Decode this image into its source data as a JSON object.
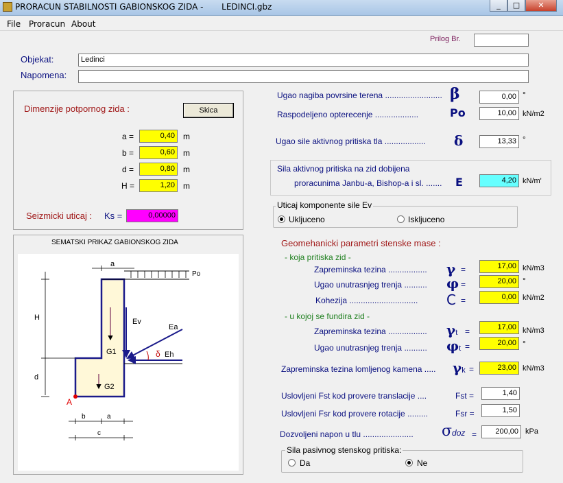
{
  "window": {
    "title": "PRORACUN STABILNOSTI GABIONSKOG ZIDA -       LEDINCI.gbz",
    "minimize": "_",
    "maximize": "□",
    "close": "✕"
  },
  "menu": [
    "File",
    "Proracun",
    "About"
  ],
  "prilog": {
    "label": "Prilog Br.",
    "value": ""
  },
  "objekat": {
    "label": "Objekat:",
    "value": "Ledinci"
  },
  "napomena": {
    "label": "Napomena:",
    "value": ""
  },
  "dimenzije": {
    "title": "Dimenzije potpornog zida :",
    "skica_button": "Skica",
    "fields": [
      {
        "name": "a =",
        "value": "0,40",
        "unit": "m"
      },
      {
        "name": "b =",
        "value": "0,60",
        "unit": "m"
      },
      {
        "name": "d =",
        "value": "0,80",
        "unit": "m"
      },
      {
        "name": "H =",
        "value": "1,20",
        "unit": "m"
      }
    ],
    "seizmicki_label": "Seizmicki uticaj :",
    "ks_label": "Ks =",
    "ks_value": "0,00000"
  },
  "schematic": {
    "title": "SEMATSKI PRIKAZ GABIONSKOG ZIDA",
    "labels": {
      "a": "a",
      "Po": "Po",
      "H": "H",
      "Ev": "Ev",
      "Ea": "Ea",
      "G1": "G1",
      "delta": "δ",
      "Eh": "Eh",
      "d": "d",
      "G2": "G2",
      "A": "A",
      "b": "b",
      "a2": "a",
      "c": "c"
    }
  },
  "right": {
    "beta": {
      "label": "Ugao nagiba povrsine terena",
      "dots": ".........................",
      "symbol": "β",
      "value": "0,00",
      "unit": "°"
    },
    "po": {
      "label": "Raspodeljeno opterecenje",
      "dots": "...................",
      "symbol": "Po",
      "value": "10,00",
      "unit": "kN/m2"
    },
    "delta": {
      "label": "Ugao sile aktivnog pritiska tla",
      "dots": "..................",
      "symbol": "δ",
      "value": "13,33",
      "unit": "°"
    },
    "e": {
      "line1": "Sila aktivnog pritiska na zid  dobijena",
      "line2": "proracunima Janbu-a, Bishop-a i sl.",
      "dots": ".......",
      "symbol": "E",
      "value": "4,20",
      "unit": "kN/m'"
    },
    "ev_group": {
      "title": "Uticaj komponente sile Ev",
      "opt1": "Ukljuceno",
      "opt2": "Iskljuceno",
      "selected": 1
    },
    "geo_title": "Geomehanicki parametri stenske mase :",
    "sub1": "- koja pritiska zid -",
    "sub2": "- u kojoj se fundira zid -",
    "gamma": {
      "label": "Zapreminska tezina",
      "dots": ".................",
      "symbol": "γ",
      "eq": "=",
      "value": "17,00",
      "unit": "kN/m3"
    },
    "phi": {
      "label": "Ugao unutrasnjeg trenja",
      "dots": "..........",
      "symbol": "φ",
      "eq": "=",
      "value": "20,00",
      "unit": "°"
    },
    "coh": {
      "label": "Kohezija",
      "dots": "..............................",
      "symbol": "C",
      "eq": "=",
      "value": "0,00",
      "unit": "kN/m2"
    },
    "gamma_t": {
      "label": "Zapreminska tezina",
      "dots": ".................",
      "symbol": "γ",
      "sub": "t",
      "eq": "=",
      "value": "17,00",
      "unit": "kN/m3"
    },
    "phi_t": {
      "label": "Ugao unutrasnjeg trenja",
      "dots": "..........",
      "symbol": "φ",
      "sub": "t",
      "eq": "=",
      "value": "20,00",
      "unit": "°"
    },
    "gamma_k": {
      "label": "Zapreminska tezina lomljenog kamena",
      "dots": ".....",
      "symbol": "γ",
      "sub": "k",
      "eq": "=",
      "value": "23,00",
      "unit": "kN/m3"
    },
    "fst": {
      "label": "Uslovljeni Fst  kod provere translacije",
      "dots": "....",
      "symbol": "Fst =",
      "value": "1,40"
    },
    "fsr": {
      "label": "Uslovljeni Fsr  kod provere rotacije",
      "dots": ".........",
      "symbol": "Fsr =",
      "value": "1,50"
    },
    "sdoz": {
      "label": "Dozvoljeni napon u tlu",
      "dots": "......................",
      "symbol": "σ",
      "sub": "doz",
      "eq": "=",
      "value": "200,00",
      "unit": "kPa"
    },
    "pas_group": {
      "title": "Sila pasivnog stenskog pritiska:",
      "opt1": "Da",
      "opt2": "Ne",
      "selected": 2
    }
  },
  "colors": {
    "input_yellow": "#ffff00",
    "input_cyan": "#66ffff",
    "input_magenta": "#ff00ff",
    "label_red": "#a01818",
    "label_green": "#208020",
    "symbol_navy": "#0a1080"
  }
}
